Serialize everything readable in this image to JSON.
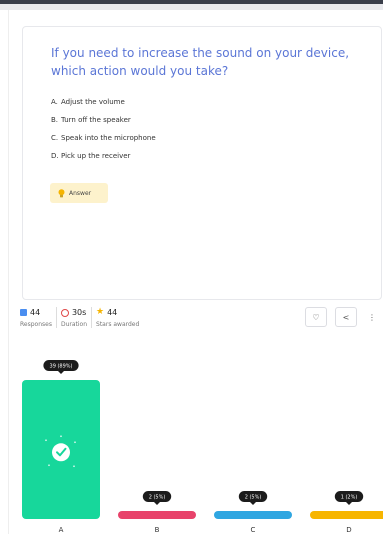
{
  "question": {
    "text": "If you need to increase the sound on your device, which action would you take?",
    "options": [
      {
        "letter": "A.",
        "text": "Adjust the volume"
      },
      {
        "letter": "B.",
        "text": "Turn off the speaker"
      },
      {
        "letter": "C.",
        "text": "Speak into the microphone"
      },
      {
        "letter": "D.",
        "text": "Pick up the receiver"
      }
    ],
    "answer_label": "Answer"
  },
  "stats": {
    "responses": {
      "value": "44",
      "label": "Responses",
      "icon": "responses-icon"
    },
    "duration": {
      "value": "30s",
      "label": "Duration",
      "icon": "clock-icon"
    },
    "stars": {
      "value": "44",
      "label": "Stars awarded",
      "icon": "star-icon"
    }
  },
  "actions": [
    {
      "name": "like-button",
      "icon": "heart-icon",
      "glyph": "♡"
    },
    {
      "name": "share-button",
      "icon": "share-icon",
      "glyph": "<"
    },
    {
      "name": "more-button",
      "icon": "more-vertical-icon",
      "glyph": "⋮"
    }
  ],
  "chart_data": {
    "type": "bar",
    "categories": [
      "A",
      "B",
      "C",
      "D"
    ],
    "values": [
      39,
      2,
      2,
      1
    ],
    "data_labels": [
      "39 (89%)",
      "2 (5%)",
      "2 (5%)",
      "1 (2%)"
    ],
    "colors": [
      "#17d79b",
      "#e8436b",
      "#2fa6e1",
      "#f7b500"
    ],
    "correct_index": 0,
    "ylim": [
      0,
      39
    ]
  },
  "colors": {
    "question": "#5b76d6",
    "answer_bg": "#fdf2cc",
    "tooltip_bg": "#1c1c1c"
  }
}
